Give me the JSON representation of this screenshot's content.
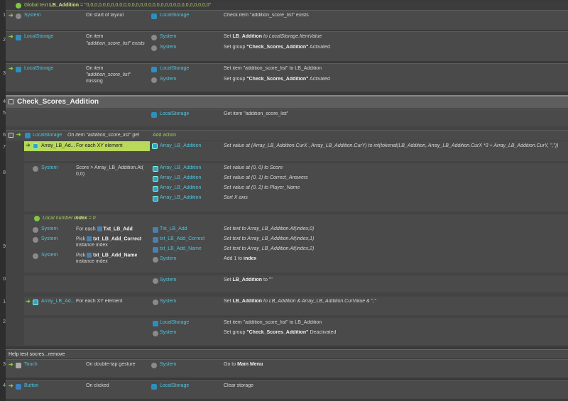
{
  "global_var": {
    "prefix": "Global text",
    "name": "LB_Addition",
    "value": "= \"0,0,0,0,0,0,0,0,0,0,0,0,0,0,0,0,0,0,0,0,0,0,0,0,0,0,0,0,0,0\""
  },
  "line_numbers": [
    "1",
    "2",
    "3",
    "4",
    "5",
    "6",
    "7",
    "8",
    "9",
    "0",
    "1",
    "2",
    "3",
    "4"
  ],
  "ev1": {
    "obj": "System",
    "cond": "On start of layout",
    "a_obj": "LocalStorage",
    "a_text": "Check item \"addition_score_list\" exists"
  },
  "ev2": {
    "obj": "LocalStorage",
    "cond_l1": "On item",
    "cond_l2": "\"addition_score_list\" exists",
    "a1_obj": "System",
    "a1_pre": "Set",
    "a1_b": "LB_Addition",
    "a1_post": "to LocalStorage.ItemValue",
    "a2_obj": "System",
    "a2_pre": "Set group",
    "a2_b": "\"Check_Scores_Addition\"",
    "a2_post": "Activated"
  },
  "ev3": {
    "obj": "LocalStorage",
    "cond_l1": "On item",
    "cond_l2": "\"addition_score_list\"",
    "cond_l3": "missing",
    "a1_obj": "LocalStorage",
    "a1_text": "Set item \"addition_score_list\" to LB_Addition",
    "a2_obj": "System",
    "a2_pre": "Set group",
    "a2_b": "\"Check_Scores_Addition\"",
    "a2_post": "Activated"
  },
  "group_title": "Check_Scores_Addition",
  "ev5": {
    "a_obj": "LocalStorage",
    "a_text": "Get item \"addition_score_list\""
  },
  "ev6": {
    "obj": "LocalStorage",
    "cond": "On item \"addition_score_list\" get",
    "add_action": "Add action"
  },
  "ev7": {
    "obj": "Array_LB_Ad...",
    "cond": "For each XY element",
    "a_obj": "Array_LB_Addition",
    "a_text": "Set value at (Array_LB_Addition.CurX , Array_LB_Addition.CurY) to int(tokenat(LB_Addition, Array_LB_Addition.CurX *3 + Array_LB_Addition.CurY, \",\"))"
  },
  "ev8": {
    "obj": "System",
    "cond_l1": "Score > Array_LB_Addition.At(",
    "cond_l2": "0,0)",
    "actions": [
      {
        "obj": "Array_LB_Addition",
        "text": "Set value at (0, 0) to Score"
      },
      {
        "obj": "Array_LB_Addition",
        "text": "Set value at (0, 1) to Correct_Answers"
      },
      {
        "obj": "Array_LB_Addition",
        "text": "Set value at (0, 2) to Player_Name"
      },
      {
        "obj": "Array_LB_Addition",
        "text": "Sort X axis"
      }
    ]
  },
  "ev9": {
    "local_pre": "Local number",
    "local_name": "index",
    "local_val": "= 0",
    "c1_obj": "System",
    "c1_pre": "For each",
    "c1_b": "Txt_LB_Add",
    "c2_obj": "System",
    "c2_pre": "Pick",
    "c2_b": "txt_LB_Add_Correct",
    "c2_l2": "instance index",
    "c3_obj": "System",
    "c3_pre": "Pick",
    "c3_b": "txt_LB_Add_Name",
    "c3_l2": "instance index",
    "actions": [
      {
        "obj": "Txt_LB_Add",
        "text": "Set text to Array_LB_Addition.At(index,0)"
      },
      {
        "obj": "txt_LB_Add_Correct",
        "text": "Set text to Array_LB_Addition.At(index,1)"
      },
      {
        "obj": "txt_LB_Add_Name",
        "text": "Set text to Array_LB_Addition.At(index,2)"
      }
    ],
    "a4_obj": "System",
    "a4_pre": "Add 1 to",
    "a4_b": "index"
  },
  "ev10": {
    "a_obj": "System",
    "a_pre": "Set",
    "a_b": "LB_Addition",
    "a_post": "to \"\""
  },
  "ev11": {
    "obj": "Array_LB_Ad...",
    "cond": "For each XY element",
    "a_obj": "System",
    "a_pre": "Set",
    "a_b": "LB_Addition",
    "a_post": "to LB_Addition & Array_LB_Addition.CurValue & \",\""
  },
  "ev12": {
    "a1_obj": "LocalStorage",
    "a1_text": "Set item \"addition_score_list\" to LB_Addition",
    "a2_obj": "System",
    "a2_pre": "Set group",
    "a2_b": "\"Check_Scores_Addition\"",
    "a2_post": "Deactivated"
  },
  "comment": "Help test socres...remove",
  "ev13": {
    "obj": "Touch",
    "cond": "On double-tap gesture",
    "a_obj": "System",
    "a_pre": "Go to",
    "a_b": "Main Menu"
  },
  "ev14": {
    "obj": "Button",
    "cond": "On clicked",
    "a_obj": "LocalStorage",
    "a_text": "Clear storage"
  }
}
